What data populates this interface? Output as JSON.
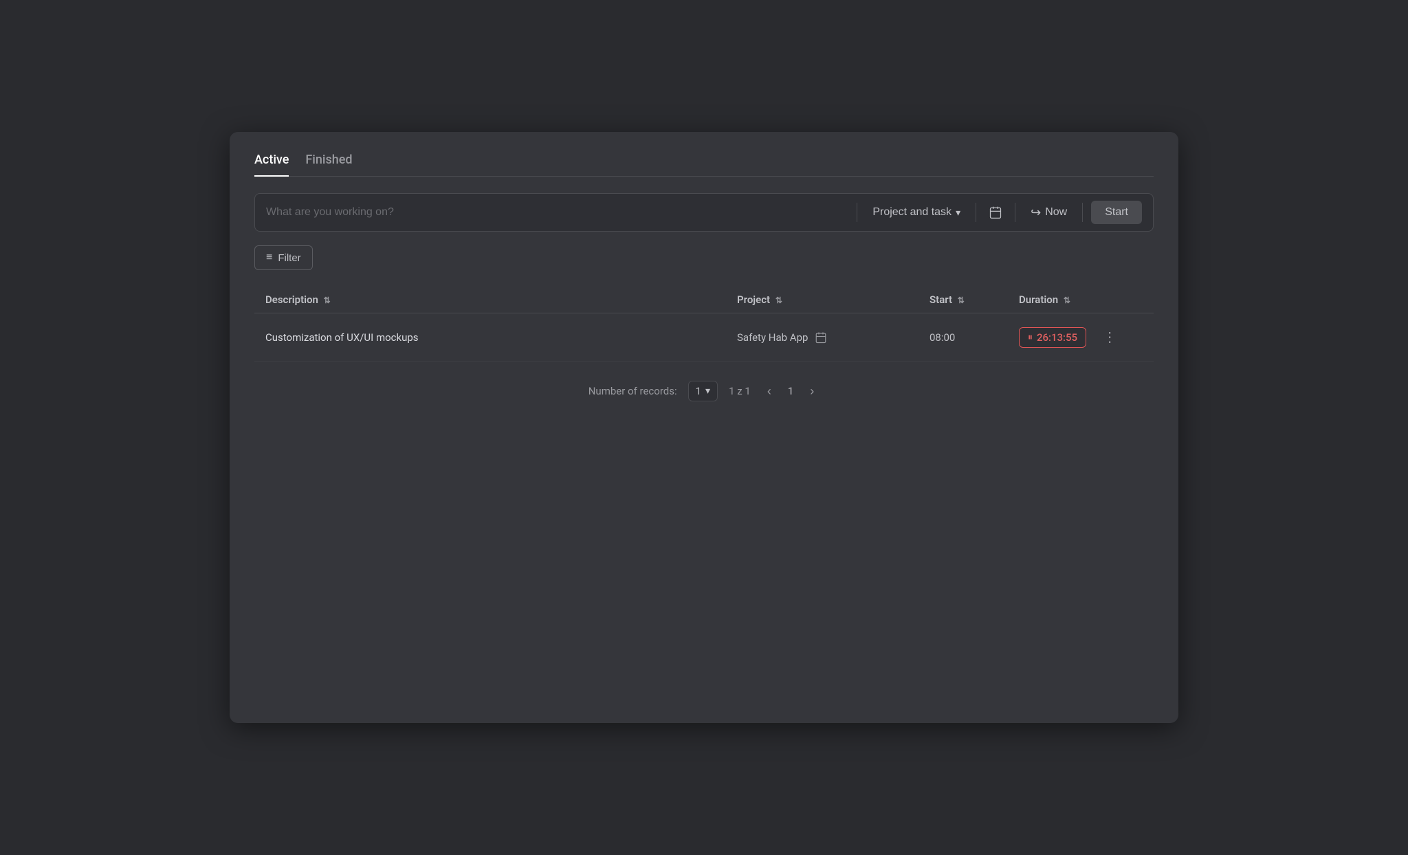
{
  "tabs": [
    {
      "label": "Active",
      "active": true
    },
    {
      "label": "Finished",
      "active": false
    }
  ],
  "search": {
    "placeholder": "What are you working on?",
    "project_task_label": "Project and task",
    "now_label": "Now",
    "start_label": "Start"
  },
  "filter": {
    "label": "Filter"
  },
  "table": {
    "columns": {
      "description": "Description",
      "project": "Project",
      "start": "Start",
      "duration": "Duration"
    },
    "rows": [
      {
        "description": "Customization of UX/UI mockups",
        "project": "Safety Hab App",
        "start": "08:00",
        "duration": "26:13:55"
      }
    ]
  },
  "pagination": {
    "records_label": "Number of records:",
    "records_count": "1",
    "page_info": "1 z 1",
    "current_page": "1"
  }
}
